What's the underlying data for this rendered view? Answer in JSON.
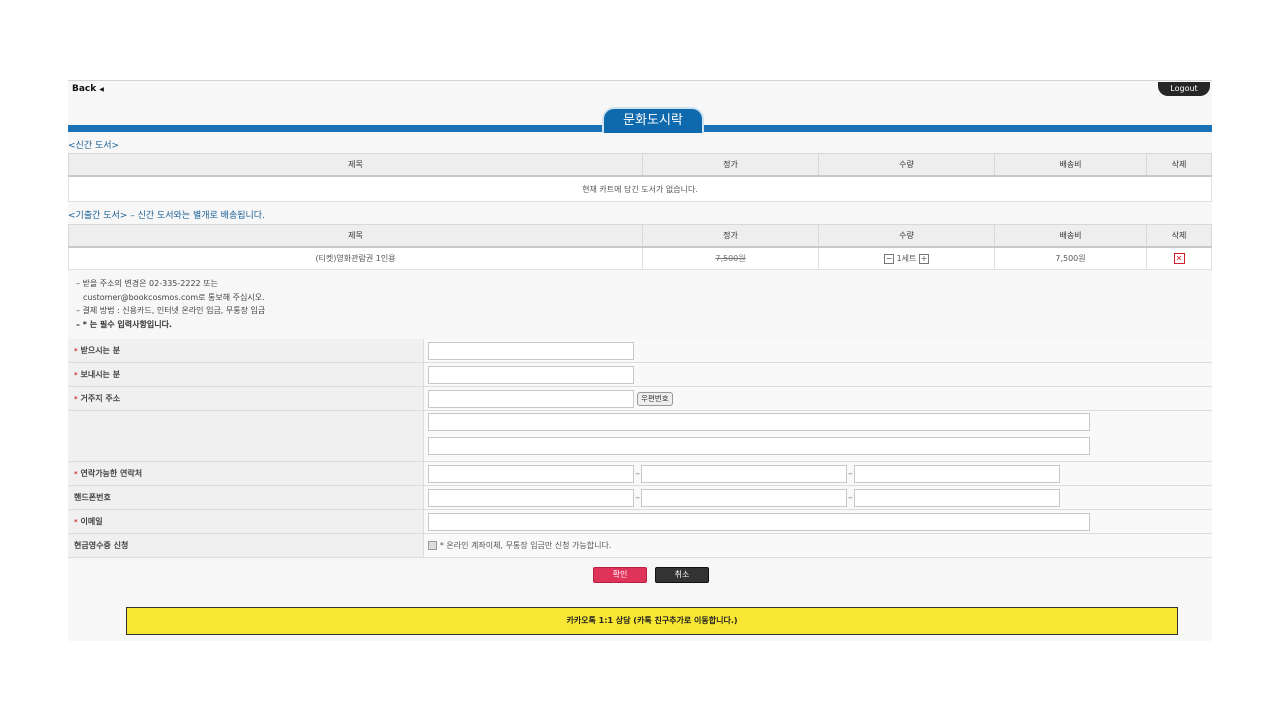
{
  "nav": {
    "back_label": "Back",
    "logout_label": "Logout"
  },
  "header": {
    "title": "문화도시락"
  },
  "new_books": {
    "label": "<신간 도서>",
    "columns": [
      "제목",
      "정가",
      "수량",
      "배송비",
      "삭제"
    ],
    "empty_message": "현재 카트에 담긴 도서가 없습니다."
  },
  "old_books": {
    "label": "<기출간 도서>",
    "note": "– 신간 도서와는 별개로 배송됩니다.",
    "columns": [
      "제목",
      "정가",
      "수량",
      "배송비",
      "삭제"
    ],
    "rows": [
      {
        "title": "(티켓)영화관람권 1인용",
        "price": "7,500원",
        "qty": "1세트",
        "shipping": "7,500원"
      }
    ]
  },
  "notes": {
    "line1": "– 받을 주소의 변경은 02-335-2222 또는",
    "line2": "customer@bookcosmos.com로 통보해 주십시오.",
    "line3": "– 결제 방법 : 신용카드, 인터넷 온라인 입금, 무통장 입금",
    "line4": "– * 는 필수 입력사항입니다."
  },
  "form": {
    "star": "*",
    "recipient_label": "받으시는 분",
    "sender_label": "보내시는 분",
    "address_label": "거주지 주소",
    "zip_button": "우편번호",
    "contact_label": "연락가능한 연락처",
    "mobile_label": "핸드폰번호",
    "email_label": "이메일",
    "receipt_label": "현금영수증 신청",
    "receipt_text": "* 온라인 계좌이체, 무통장 입금만 신청 가능합니다.",
    "dash": "–"
  },
  "actions": {
    "confirm": "확인",
    "cancel": "취소"
  },
  "kakao": {
    "label": "카카오톡 1:1 상담 (카톡 친구추가로 이동합니다.)"
  },
  "colors": {
    "brand_blue": "#1a73b8",
    "confirm_pink": "#e0335a",
    "kakao_yellow": "#f8e634"
  }
}
